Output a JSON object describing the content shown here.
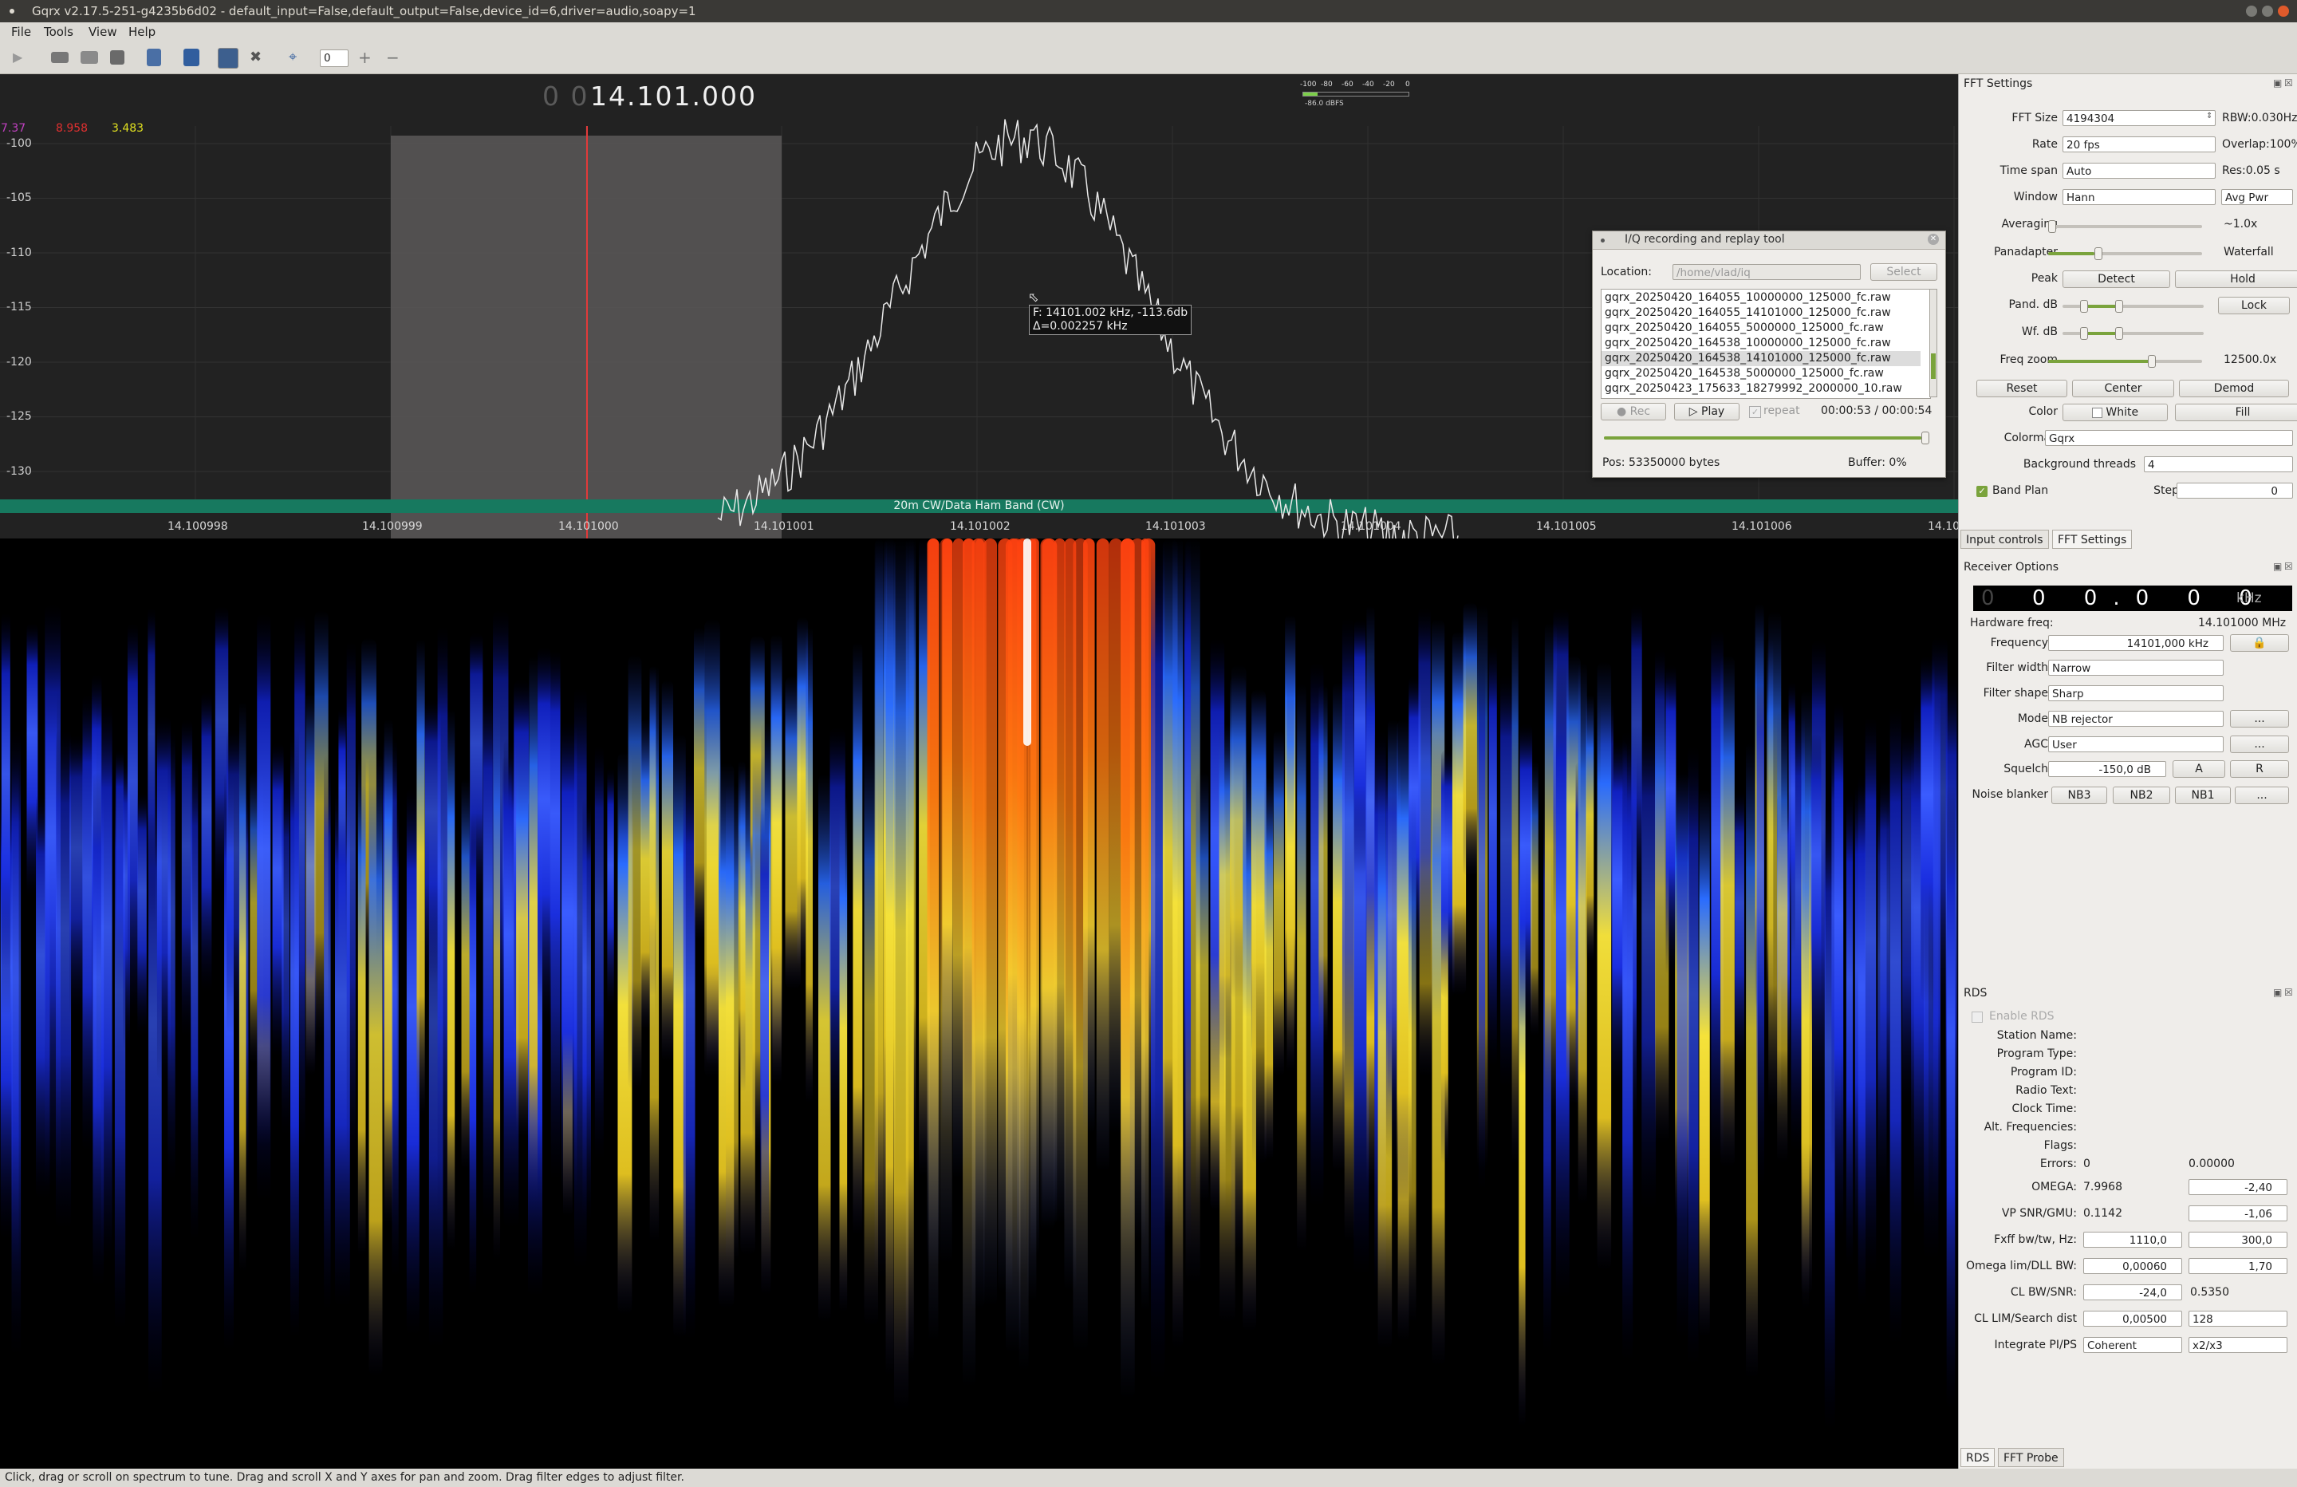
{
  "window": {
    "title": "Gqrx v2.17.5-251-g4235b6d02 - default_input=False,default_output=False,device_id=6,driver=audio,soapy=1"
  },
  "menu": {
    "file": "File",
    "tools": "Tools",
    "view": "View",
    "help": "Help"
  },
  "toolbar": {
    "spin_value": "0"
  },
  "spectrum": {
    "freq_prefix": "0 0",
    "freq_display": "14.101.000",
    "peak_vals": {
      "a": "7.37",
      "b": "8.958",
      "c": "3.483"
    },
    "y_ticks": [
      "-100",
      "-105",
      "-110",
      "-115",
      "-120",
      "-125",
      "-130"
    ],
    "x_ticks": [
      "14.100998",
      "14.100999",
      "14.101000",
      "14.101001",
      "14.101002",
      "14.101003",
      "14.101004",
      "14.101005",
      "14.101006",
      "14.10"
    ],
    "band_label": "20m CW/Data Ham Band (CW)",
    "cursor_tooltip_line1": "F: 14101.002 kHz, -113.6db",
    "cursor_tooltip_line2": "Δ=0.002257 kHz",
    "meter_ticks": [
      "-100",
      "-80",
      "-60",
      "-40",
      "-20",
      "0"
    ],
    "meter_value": "-86.0 dBFS",
    "colors": {
      "background": "#222222",
      "trace": "#e8e8e8",
      "band": "#17795f",
      "filter": "#5b5858",
      "tuned": "#e23a3a"
    }
  },
  "iq_tool": {
    "title": "I/Q recording and replay tool",
    "location_label": "Location:",
    "location_value": "/home/vlad/iq",
    "select_label": "Select",
    "files": [
      "gqrx_20250420_164055_10000000_125000_fc.raw",
      "gqrx_20250420_164055_14101000_125000_fc.raw",
      "gqrx_20250420_164055_5000000_125000_fc.raw",
      "gqrx_20250420_164538_10000000_125000_fc.raw",
      "gqrx_20250420_164538_14101000_125000_fc.raw",
      "gqrx_20250420_164538_5000000_125000_fc.raw",
      "gqrx_20250423_175633_18279992_2000000_10.raw"
    ],
    "selected_index": 4,
    "rec_label": "Rec",
    "play_label": "Play",
    "repeat_label": "repeat",
    "time": "00:00:53 / 00:00:54",
    "pos": "Pos: 53350000 bytes",
    "buffer": "Buffer: 0%",
    "progress": 0.98
  },
  "fft": {
    "title": "FFT Settings",
    "fft_size_label": "FFT Size",
    "fft_size": "4194304",
    "rbw": "RBW:0.030Hz",
    "rate_label": "Rate",
    "rate": "20 fps",
    "overlap": "Overlap:100%",
    "timespan_label": "Time span",
    "timespan": "Auto",
    "res": "Res:0.05 s",
    "window_label": "Window",
    "window": "Hann",
    "avg_mode": "Avg Pwr",
    "averaging_label": "Averaging",
    "averaging_value": "~1.0x",
    "averaging_level": 0.0,
    "panadapter_label": "Panadapter",
    "waterfall_label": "Waterfall",
    "pan_level": 0.3,
    "peak_label": "Peak",
    "detect": "Detect",
    "hold": "Hold",
    "pand_db_label": "Pand. dB",
    "lock": "Lock",
    "wf_db_label": "Wf. dB",
    "freq_zoom_label": "Freq zoom",
    "freq_zoom": "12500.0x",
    "zoom_level": 0.67,
    "reset": "Reset",
    "center": "Center",
    "demod": "Demod",
    "color_label": "Color",
    "white": "White",
    "fill": "Fill",
    "colormap_label": "Colormap",
    "colormap": "Gqrx",
    "bg_threads_label": "Background threads",
    "bg_threads": "4",
    "band_plan_label": "Band Plan",
    "step_label": "Step",
    "step": "0"
  },
  "tabs_top": {
    "input": "Input controls",
    "fft": "FFT Settings"
  },
  "receiver": {
    "title": "Receiver Options",
    "lnb_digits": "0 0.0 0 0",
    "lnb_unit": "kHz",
    "hw_freq_label": "Hardware freq:",
    "hw_freq": "14.101000 MHz",
    "frequency_label": "Frequency",
    "frequency": "14101,000 kHz",
    "filter_width_label": "Filter width",
    "filter_width": "Narrow",
    "filter_shape_label": "Filter shape",
    "filter_shape": "Sharp",
    "mode_label": "Mode",
    "mode": "NB rejector",
    "agc_label": "AGC",
    "agc": "User",
    "squelch_label": "Squelch",
    "squelch": "-150,0 dB",
    "sq_a": "A",
    "sq_r": "R",
    "nb_label": "Noise blanker",
    "nb3": "NB3",
    "nb2": "NB2",
    "nb1": "NB1",
    "dots": "..."
  },
  "rds": {
    "title": "RDS",
    "enable": "Enable RDS",
    "station_name": "Station Name:",
    "program_type": "Program Type:",
    "program_id": "Program ID:",
    "radio_text": "Radio Text:",
    "clock_time": "Clock Time:",
    "alt_freq": "Alt. Frequencies:",
    "flags": "Flags:",
    "errors_label": "Errors:",
    "errors": "0",
    "errors_right": "0.00000",
    "omega_label": "OMEGA:",
    "omega": "7.9968",
    "omega_spin": "-2,40",
    "vp_label": "VP SNR/GMU:",
    "vp": "0.1142",
    "vp_spin": "-1,06",
    "fxff_label": "Fxff bw/tw, Hz:",
    "fxff_a": "1110,0",
    "fxff_b": "300,0",
    "omlim_label": "Omega lim/DLL BW:",
    "omlim_a": "0,00060",
    "omlim_b": "1,70",
    "clbw_label": "CL BW/SNR:",
    "clbw_a": "-24,0",
    "clbw_b": "0.5350",
    "cllim_label": "CL LIM/Search dist",
    "cllim_a": "0,00500",
    "cllim_b": "128",
    "integrate_label": "Integrate PI/PS",
    "integrate_a": "Coherent",
    "integrate_b": "x2/x3"
  },
  "tabs_bottom": {
    "rds": "RDS",
    "probe": "FFT Probe"
  },
  "status": "Click, drag or scroll on spectrum to tune. Drag and scroll X and Y axes for pan and zoom. Drag filter edges to adjust filter."
}
